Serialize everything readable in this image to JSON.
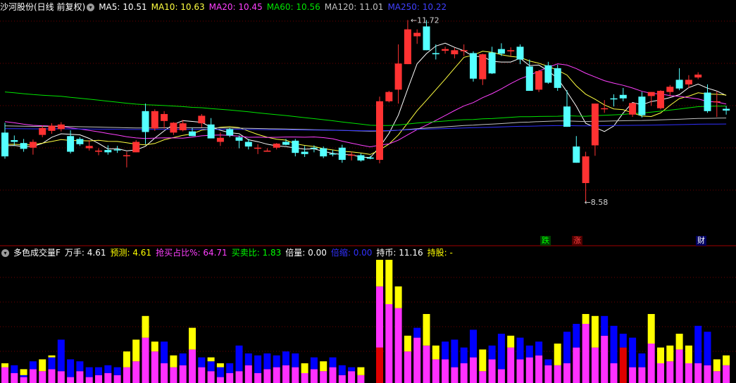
{
  "colors": {
    "up": "#ff3232",
    "down": "#54ffff",
    "ma5": "#ffffff",
    "ma10": "#ffff40",
    "ma20": "#ff40ff",
    "ma60": "#00e400",
    "ma120": "#c0c0c0",
    "ma250": "#3030ff",
    "vol_pink": "#ff30ff",
    "vol_yellow": "#ffff00",
    "vol_blue": "#0000ff",
    "vol_red": "#e00000",
    "grid": "#700000",
    "divider": "#a00000"
  },
  "price_panel": {
    "title": "沙河股份(日线 前复权)",
    "ma": [
      {
        "label": "MA5: 10.51",
        "color": "#ffffff"
      },
      {
        "label": "MA10: 10.63",
        "color": "#ffff40"
      },
      {
        "label": "MA20: 10.45",
        "color": "#ff40ff"
      },
      {
        "label": "MA60: 10.56",
        "color": "#00e400"
      },
      {
        "label": "MA120: 11.01",
        "color": "#c0c0c0"
      },
      {
        "label": "MA250: 10.22",
        "color": "#4040ff"
      }
    ],
    "high_label": "11.72",
    "low_label": "8.58",
    "events": [
      {
        "text": "跌",
        "bg": "#004000",
        "color": "#00ff00"
      },
      {
        "text": "涨",
        "bg": "#500000",
        "color": "#ff4040"
      },
      {
        "text": "财",
        "bg": "#000060",
        "color": "#ffffff"
      }
    ]
  },
  "indicator_panel": {
    "title": "多色成交量F",
    "fields": [
      {
        "label": "万手: 4.61",
        "color": "#ffffff"
      },
      {
        "label": "预测: 4.61",
        "color": "#ffff00"
      },
      {
        "label": "抢买占比%: 64.71",
        "color": "#ff40ff"
      },
      {
        "label": "买卖比: 1.83",
        "color": "#00ff00"
      },
      {
        "label": "倍量: 0.00",
        "color": "#ffffff"
      },
      {
        "label": "倍缩: 0.00",
        "color": "#3030ff"
      },
      {
        "label": "持币: 11.16",
        "color": "#ffffff"
      },
      {
        "label": "持股: -",
        "color": "#ffff00"
      }
    ]
  },
  "candles": [
    [
      9.78,
      9.95,
      9.33,
      9.37
    ],
    [
      9.65,
      9.73,
      9.55,
      9.62
    ],
    [
      9.6,
      9.67,
      9.45,
      9.5
    ],
    [
      9.52,
      9.66,
      9.4,
      9.62
    ],
    [
      9.74,
      9.9,
      9.7,
      9.86
    ],
    [
      9.81,
      9.94,
      9.76,
      9.9
    ],
    [
      9.84,
      9.96,
      9.8,
      9.92
    ],
    [
      9.72,
      9.82,
      9.42,
      9.45
    ],
    [
      9.67,
      9.7,
      9.55,
      9.58
    ],
    [
      9.51,
      9.65,
      9.47,
      9.55
    ],
    [
      9.45,
      9.51,
      9.39,
      9.47
    ],
    [
      9.48,
      9.56,
      9.4,
      9.44
    ],
    [
      9.49,
      9.55,
      9.43,
      9.48
    ],
    [
      9.39,
      9.45,
      9.18,
      9.39
    ],
    [
      9.44,
      9.65,
      9.44,
      9.62
    ],
    [
      10.15,
      10.28,
      9.58,
      9.79
    ],
    [
      9.85,
      10.18,
      9.81,
      10.15
    ],
    [
      9.98,
      10.15,
      9.85,
      10.1
    ],
    [
      9.78,
      9.96,
      9.74,
      9.95
    ],
    [
      9.82,
      10.0,
      9.8,
      9.94
    ],
    [
      9.8,
      9.86,
      9.72,
      9.72
    ],
    [
      9.94,
      10.1,
      9.87,
      10.07
    ],
    [
      9.92,
      10.03,
      9.68,
      9.68
    ],
    [
      9.62,
      9.78,
      9.55,
      9.69
    ],
    [
      9.84,
      9.86,
      9.7,
      9.73
    ],
    [
      9.7,
      9.73,
      9.51,
      9.64
    ],
    [
      9.62,
      9.67,
      9.49,
      9.54
    ],
    [
      9.52,
      9.58,
      9.41,
      9.52
    ],
    [
      9.45,
      9.51,
      9.45,
      9.47
    ],
    [
      9.52,
      9.6,
      9.49,
      9.59
    ],
    [
      9.62,
      9.67,
      9.56,
      9.57
    ],
    [
      9.64,
      9.67,
      9.37,
      9.43
    ],
    [
      9.45,
      9.55,
      9.36,
      9.41
    ],
    [
      9.52,
      9.56,
      9.44,
      9.5
    ],
    [
      9.51,
      9.54,
      9.34,
      9.37
    ],
    [
      9.42,
      9.48,
      9.37,
      9.41
    ],
    [
      9.52,
      9.57,
      9.26,
      9.31
    ],
    [
      9.39,
      9.45,
      9.3,
      9.4
    ],
    [
      9.39,
      9.42,
      9.28,
      9.3
    ],
    [
      9.35,
      9.38,
      9.32,
      9.33
    ],
    [
      9.31,
      10.4,
      9.25,
      10.32
    ],
    [
      10.32,
      10.5,
      10.3,
      10.48
    ],
    [
      10.52,
      11.3,
      10.28,
      10.97
    ],
    [
      10.96,
      11.72,
      10.96,
      11.56
    ],
    [
      11.44,
      11.56,
      11.31,
      11.5
    ],
    [
      11.61,
      11.72,
      11.2,
      11.2
    ],
    [
      11.15,
      11.3,
      11.04,
      11.13
    ],
    [
      11.19,
      11.26,
      11.14,
      11.22
    ],
    [
      11.13,
      11.24,
      11.06,
      11.2
    ],
    [
      11.19,
      11.3,
      11.1,
      11.2
    ],
    [
      11.15,
      11.18,
      10.66,
      10.71
    ],
    [
      10.7,
      11.14,
      10.6,
      11.13
    ],
    [
      11.16,
      11.26,
      10.79,
      10.8
    ],
    [
      11.22,
      11.32,
      11.1,
      11.14
    ],
    [
      11.18,
      11.25,
      11.1,
      11.2
    ],
    [
      11.26,
      11.3,
      10.96,
      11.04
    ],
    [
      10.92,
      11.04,
      10.5,
      10.5
    ],
    [
      10.52,
      10.86,
      10.48,
      10.84
    ],
    [
      10.94,
      11.0,
      10.62,
      10.64
    ],
    [
      10.89,
      10.95,
      10.5,
      10.55
    ],
    [
      10.23,
      10.51,
      9.88,
      9.88
    ],
    [
      9.54,
      9.72,
      9.26,
      9.26
    ],
    [
      8.91,
      9.45,
      8.58,
      9.37
    ],
    [
      9.56,
      10.28,
      9.38,
      10.28
    ],
    [
      10.2,
      10.34,
      10.12,
      10.2
    ],
    [
      10.37,
      10.44,
      10.23,
      10.36
    ],
    [
      10.43,
      10.55,
      10.32,
      10.37
    ],
    [
      10.09,
      10.29,
      10.05,
      10.29
    ],
    [
      10.4,
      10.48,
      10.04,
      10.08
    ],
    [
      10.41,
      10.48,
      10.24,
      10.48
    ],
    [
      10.2,
      10.51,
      10.18,
      10.5
    ],
    [
      10.48,
      10.6,
      10.4,
      10.57
    ],
    [
      10.69,
      10.89,
      10.51,
      10.54
    ],
    [
      10.61,
      10.77,
      10.55,
      10.69
    ],
    [
      10.73,
      10.82,
      10.7,
      10.78
    ],
    [
      10.47,
      10.61,
      10.12,
      10.15
    ],
    [
      10.32,
      10.49,
      10.05,
      10.32
    ],
    [
      10.19,
      10.24,
      10.09,
      10.16
    ]
  ],
  "volumes": [
    [
      0.8,
      0.2,
      0
    ],
    [
      0.5,
      0,
      0.4
    ],
    [
      0.3,
      0.3,
      0.1
    ],
    [
      0.7,
      0,
      0.4
    ],
    [
      0.6,
      0.6,
      0
    ],
    [
      0.7,
      0.1,
      0.6
    ],
    [
      0.6,
      0,
      1.6
    ],
    [
      0.3,
      0,
      0.9
    ],
    [
      0.6,
      0,
      0.5
    ],
    [
      0.3,
      0,
      0.5
    ],
    [
      0.4,
      0,
      0.4
    ],
    [
      0.5,
      0,
      0.4
    ],
    [
      0.4,
      0,
      0.4
    ],
    [
      0.8,
      0.8,
      0
    ],
    [
      1.1,
      1.1,
      0
    ],
    [
      2.3,
      1.1,
      0
    ],
    [
      1.6,
      0.5,
      0
    ],
    [
      1.0,
      0,
      1.1
    ],
    [
      0.8,
      0.6,
      0
    ],
    [
      0.9,
      0,
      0.6
    ],
    [
      1.7,
      1.1,
      0
    ],
    [
      0.8,
      0,
      0.5
    ],
    [
      0.6,
      0.2,
      0.5
    ],
    [
      0.3,
      0.2,
      0.5
    ],
    [
      0.5,
      0,
      0.5
    ],
    [
      0.6,
      0,
      1.3
    ],
    [
      0.9,
      0,
      0.6
    ],
    [
      0.5,
      0,
      0.9
    ],
    [
      0.7,
      0,
      0.8
    ],
    [
      0.8,
      0,
      0.6
    ],
    [
      0.9,
      0,
      0.7
    ],
    [
      0.8,
      0,
      0.7
    ],
    [
      0.5,
      0.5,
      0
    ],
    [
      0.7,
      0,
      0.6
    ],
    [
      0.6,
      0.5,
      0
    ],
    [
      0.8,
      0,
      0.5
    ],
    [
      0.4,
      0,
      0.5
    ],
    [
      0.6,
      0,
      0.2
    ],
    [
      0.4,
      0.4,
      0
    ],
    [
      0.0,
      0,
      0
    ],
    [
      4.9,
      1.5,
      0
    ],
    [
      4.0,
      2.9,
      0
    ],
    [
      3.8,
      1.1,
      0
    ],
    [
      1.6,
      0.8,
      0
    ],
    [
      2.3,
      0,
      0.5
    ],
    [
      1.9,
      1.6,
      0
    ],
    [
      1.2,
      0.7,
      0
    ],
    [
      1.2,
      0,
      0.9
    ],
    [
      0.8,
      0,
      1.4
    ],
    [
      1.0,
      0,
      0.8
    ],
    [
      1.3,
      0,
      1.4
    ],
    [
      0.6,
      1.1,
      0
    ],
    [
      1.2,
      0,
      0.7
    ],
    [
      0.7,
      0,
      1.8
    ],
    [
      1.8,
      0.6,
      0
    ],
    [
      1.2,
      0,
      1.1
    ],
    [
      1.3,
      0,
      0.6
    ],
    [
      1.4,
      0,
      0.7
    ],
    [
      0.9,
      0,
      0.3
    ],
    [
      0.9,
      1.1,
      0
    ],
    [
      1.0,
      0,
      1.6
    ],
    [
      1.8,
      0,
      1.2
    ],
    [
      3.0,
      0.5,
      0
    ],
    [
      1.8,
      1.6,
      0
    ],
    [
      2.4,
      0,
      1.0
    ],
    [
      1.0,
      0,
      1.9
    ],
    [
      1.0,
      0,
      0.7
    ],
    [
      0.8,
      0,
      1.5
    ],
    [
      0.8,
      0,
      0.7
    ],
    [
      2.0,
      1.5,
      0
    ],
    [
      1.0,
      0.8,
      0
    ],
    [
      1.1,
      0.8,
      0
    ],
    [
      1.7,
      0.8,
      0
    ],
    [
      1.0,
      0.9,
      0
    ],
    [
      1.0,
      0,
      1.9
    ],
    [
      0.9,
      0,
      1.7
    ],
    [
      0.6,
      0.6,
      0
    ],
    [
      0.9,
      0.5,
      0
    ]
  ]
}
